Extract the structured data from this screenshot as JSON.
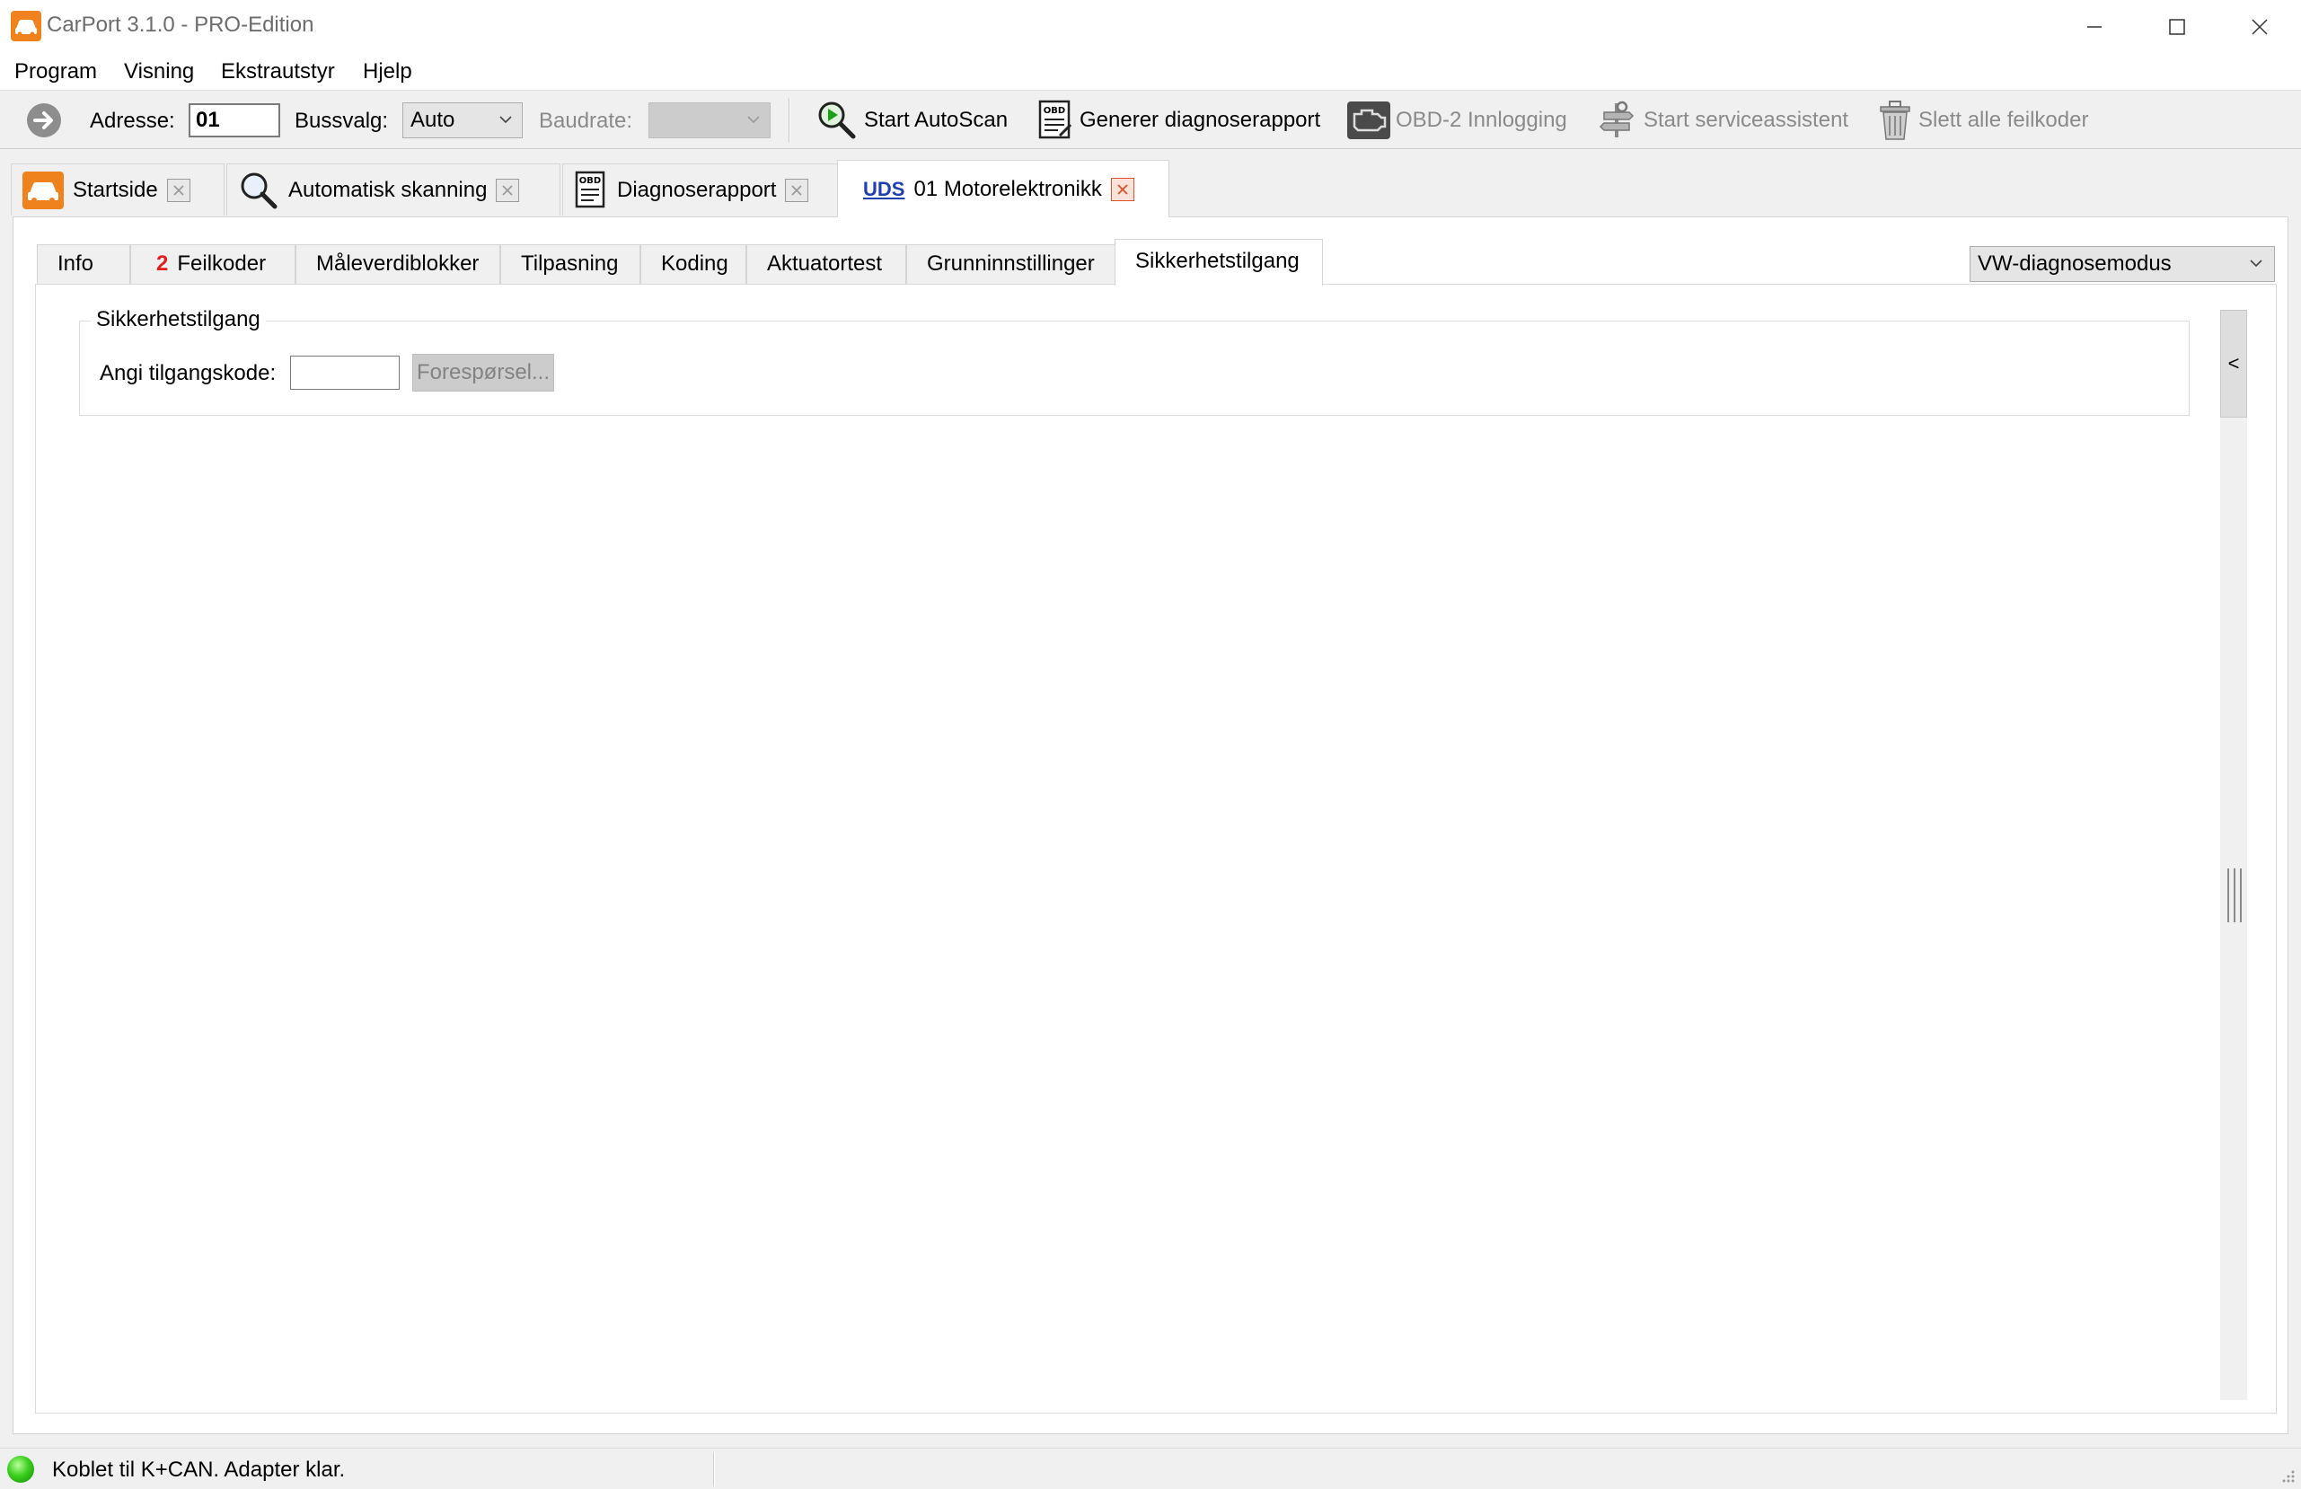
{
  "window": {
    "title": "CarPort 3.1.0 - PRO-Edition"
  },
  "menu": {
    "items": [
      "Program",
      "Visning",
      "Ekstrautstyr",
      "Hjelp"
    ]
  },
  "toolbar": {
    "address_label": "Adresse:",
    "address_value": "01",
    "bus_label": "Bussvalg:",
    "bus_value": "Auto",
    "baud_label": "Baudrate:",
    "baud_value": "",
    "start_autoscan": "Start AutoScan",
    "generate_report": "Generer diagnoserapport",
    "obd2_login": "OBD-2 Innlogging",
    "service_assistant": "Start serviceassistent",
    "clear_codes": "Slett alle feilkoder",
    "obd_icon_text": "OBD"
  },
  "doc_tabs": [
    {
      "label": "Startside"
    },
    {
      "label": "Automatisk skanning"
    },
    {
      "label": "Diagnoserapport",
      "icon_text": "OBD"
    },
    {
      "label": "01 Motorelektronikk",
      "prefix": "UDS"
    }
  ],
  "inner_tabs": [
    {
      "label": "Info"
    },
    {
      "label": "Feilkoder",
      "badge": "2"
    },
    {
      "label": "Måleverdiblokker"
    },
    {
      "label": "Tilpasning"
    },
    {
      "label": "Koding"
    },
    {
      "label": "Aktuatortest"
    },
    {
      "label": "Grunninnstillinger"
    },
    {
      "label": "Sikkerhetstilgang"
    }
  ],
  "mode_select": {
    "value": "VW-diagnosemodus"
  },
  "security": {
    "group_title": "Sikkerhetstilgang",
    "code_label": "Angi tilgangskode:",
    "code_value": "",
    "request_button": "Forespørsel..."
  },
  "side_panel": {
    "collapse_glyph": "<"
  },
  "status": {
    "text": "Koblet til K+CAN. Adapter klar."
  },
  "colors": {
    "accent_orange": "#f0821e",
    "badge_red": "#e0201c",
    "uds_blue": "#1f3fb0",
    "status_green": "#3ccf1e"
  }
}
